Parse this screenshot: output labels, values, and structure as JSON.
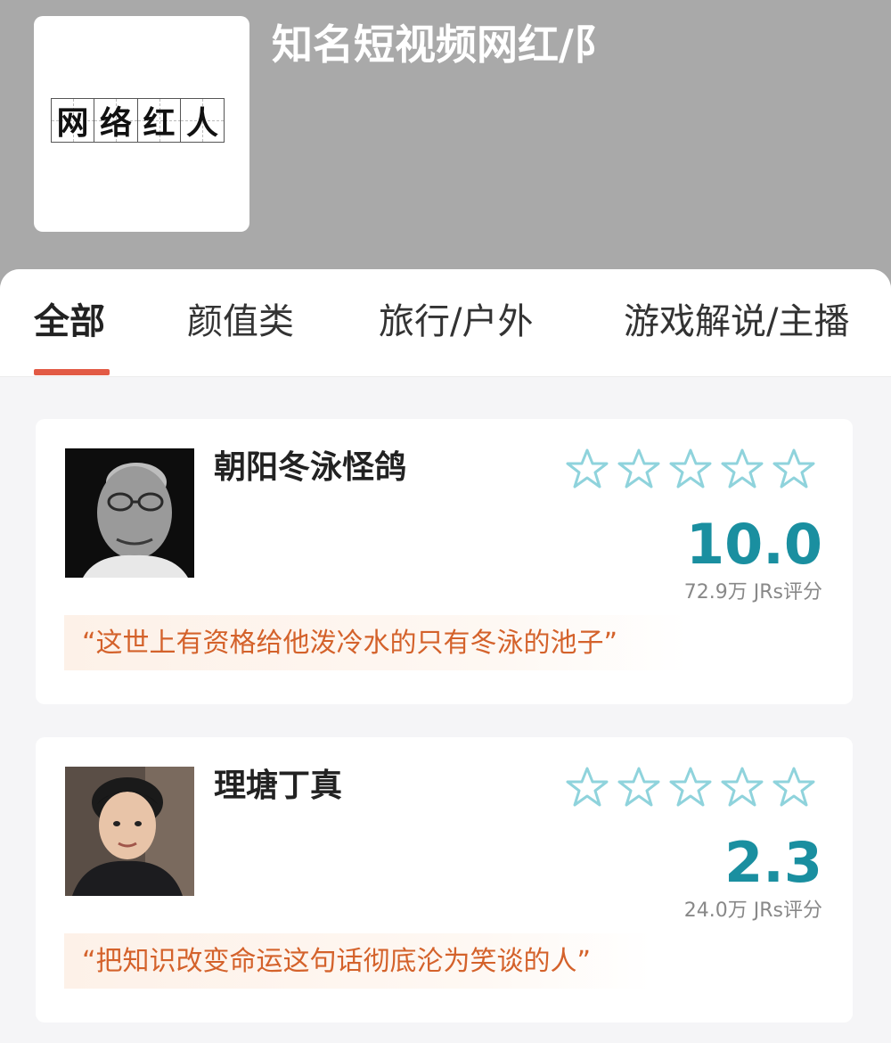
{
  "header": {
    "logo_chars": [
      "网",
      "络",
      "红",
      "人"
    ],
    "title": "知名短视频网红/阝"
  },
  "tabs": [
    {
      "label": "全部",
      "active": true
    },
    {
      "label": "颜值类",
      "active": false
    },
    {
      "label": "旅行/户外",
      "active": false
    },
    {
      "label": "游戏解说/主播",
      "active": false
    }
  ],
  "cards": [
    {
      "name": "朝阳冬泳怪鸽",
      "rating": "10.0",
      "rating_count": "72.9万 JRs评分",
      "quote": "“这世上有资格给他泼冷水的只有冬泳的池子”",
      "stars": 5
    },
    {
      "name": "理塘丁真",
      "rating": "2.3",
      "rating_count": "24.0万 JRs评分",
      "quote": "“把知识改变命运这句话彻底沦为笑谈的人”",
      "stars": 5
    }
  ],
  "colors": {
    "accent": "#e25a45",
    "score": "#1a8fa0",
    "star_outline": "#8fd3dc",
    "quote_text": "#d4622b",
    "header_bg": "#a9a9a9"
  },
  "icons": {
    "star": "star-outline-icon"
  }
}
